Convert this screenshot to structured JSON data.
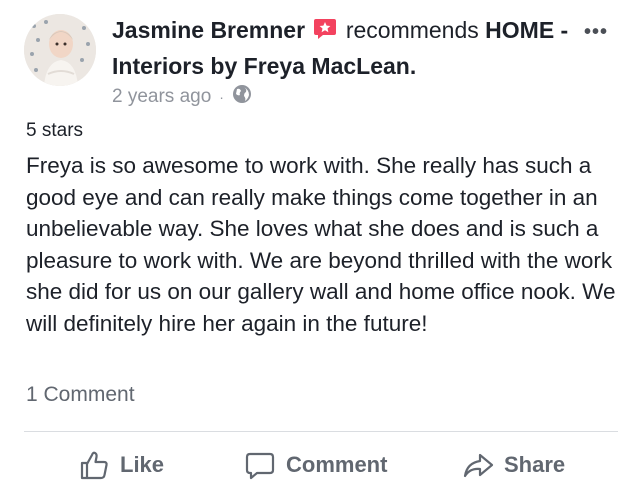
{
  "post": {
    "author_name": "Jasmine Bremner",
    "recommends_word": "recommends",
    "page_name": "HOME - Interiors by Freya MacLean.",
    "timestamp": "2 years ago",
    "meta_separator": "·",
    "privacy_icon": "globe-icon",
    "more_icon": "more-dots-icon"
  },
  "review": {
    "stars_label": "5 stars",
    "text": "Freya is so awesome to work with. She really has such a good eye and can really make things come together in an unbelievable way. She loves what she does and is such a pleasure to work with. We are beyond thrilled with the work she did for us on our gallery wall and home office nook. We will definitely hire her again in the future!"
  },
  "comments": {
    "count_label": "1 Comment"
  },
  "actions": {
    "like_label": "Like",
    "comment_label": "Comment",
    "share_label": "Share"
  },
  "colors": {
    "recommend_badge": "#f3425f",
    "secondary_text": "#90949c",
    "action_text": "#616770"
  }
}
